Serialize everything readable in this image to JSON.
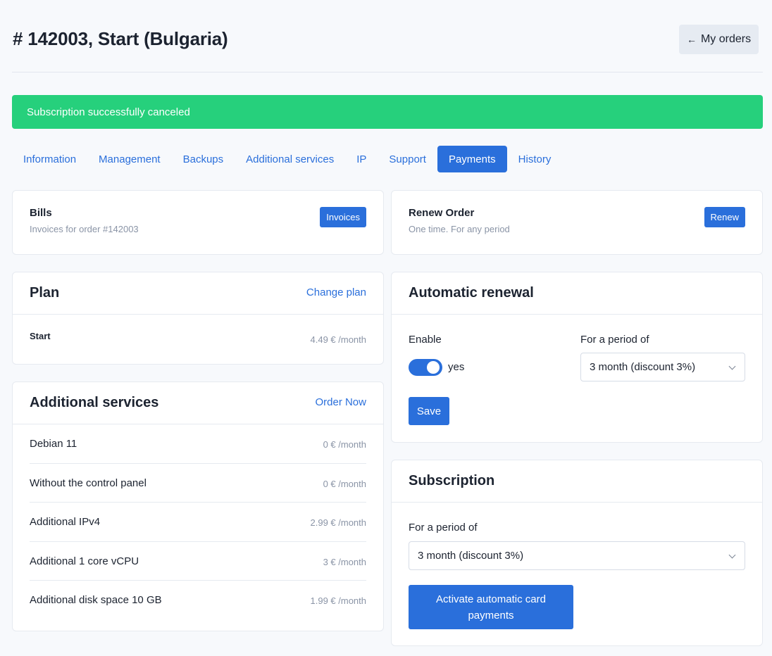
{
  "header": {
    "title": "# 142003, Start (Bulgaria)",
    "back_icon": "arrow-left-icon",
    "back_label": "My orders"
  },
  "alert": {
    "text": "Subscription successfully canceled",
    "color": "#26d07c"
  },
  "tabs": [
    {
      "label": "Information"
    },
    {
      "label": "Management"
    },
    {
      "label": "Backups"
    },
    {
      "label": "Additional services"
    },
    {
      "label": "IP"
    },
    {
      "label": "Support"
    },
    {
      "label": "Payments",
      "active": true
    },
    {
      "label": "History"
    }
  ],
  "bills": {
    "title": "Bills",
    "subtitle": "Invoices for order #142003",
    "button": "Invoices"
  },
  "renew_order": {
    "title": "Renew Order",
    "subtitle": "One time. For any period",
    "button": "Renew"
  },
  "plan": {
    "title": "Plan",
    "link": "Change plan",
    "name": "Start",
    "price": "4.49 € /month"
  },
  "additional_services": {
    "title": "Additional services",
    "link": "Order Now",
    "items": [
      {
        "label": "Debian 11",
        "price": "0 € /month"
      },
      {
        "label": "Without the control panel",
        "price": "0 € /month"
      },
      {
        "label": "Additional IPv4",
        "price": "2.99 € /month"
      },
      {
        "label": "Additional 1 core vCPU",
        "price": "3 € /month"
      },
      {
        "label": "Additional disk space 10 GB",
        "price": "1.99 € /month"
      }
    ]
  },
  "auto_renewal": {
    "title": "Automatic renewal",
    "enable_label": "Enable",
    "toggle_on": true,
    "toggle_text": "yes",
    "period_label": "For a period of",
    "period_value": "3 month (discount 3%)",
    "save_label": "Save"
  },
  "subscription": {
    "title": "Subscription",
    "period_label": "For a period of",
    "period_value": "3 month (discount 3%)",
    "activate_label": "Activate automatic card payments"
  },
  "colors": {
    "accent": "#2a6fdb",
    "success": "#26d07c",
    "background": "#f7f9fc"
  }
}
